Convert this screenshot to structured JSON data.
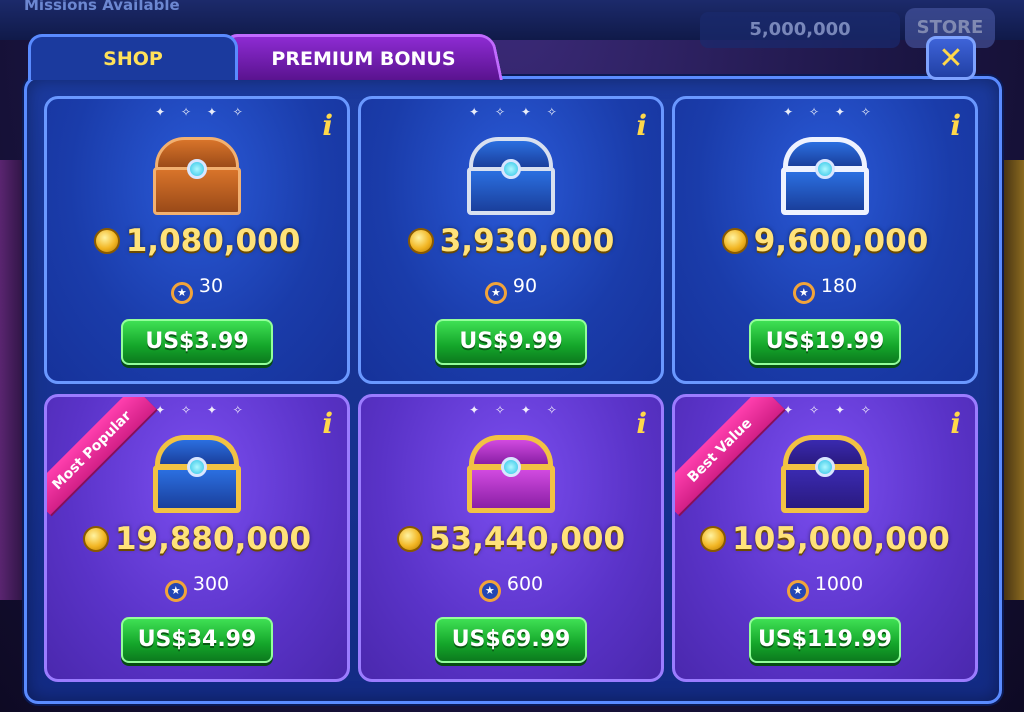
{
  "background": {
    "missions_label": "Missions Available",
    "balance": "5,000,000",
    "store_label": "STORE"
  },
  "tabs": {
    "shop": "SHOP",
    "premium": "PREMIUM BONUS"
  },
  "close_label": "✕",
  "info_label": "i",
  "sparkles": "✦ ✧ ✦ ✧",
  "colors": {
    "accent_gold": "#ffe27a",
    "buy_green": "#14a52a",
    "ribbon_pink": "#d21f86",
    "panel_blue": "#1b3a9e"
  },
  "cards": [
    {
      "chest_icon": "bronze-chest-icon",
      "coins": "1,080,000",
      "points": "30",
      "price": "US$3.99",
      "ribbon": ""
    },
    {
      "chest_icon": "silver-blue-chest-icon",
      "coins": "3,930,000",
      "points": "90",
      "price": "US$9.99",
      "ribbon": ""
    },
    {
      "chest_icon": "silver-large-chest-icon",
      "coins": "9,600,000",
      "points": "180",
      "price": "US$19.99",
      "ribbon": ""
    },
    {
      "chest_icon": "gold-blue-chest-icon",
      "coins": "19,880,000",
      "points": "300",
      "price": "US$34.99",
      "ribbon": "Most Popular"
    },
    {
      "chest_icon": "gold-magenta-chest-icon",
      "coins": "53,440,000",
      "points": "600",
      "price": "US$69.99",
      "ribbon": ""
    },
    {
      "chest_icon": "gold-cosmic-chest-icon",
      "coins": "105,000,000",
      "points": "1000",
      "price": "US$119.99",
      "ribbon": "Best Value"
    }
  ]
}
